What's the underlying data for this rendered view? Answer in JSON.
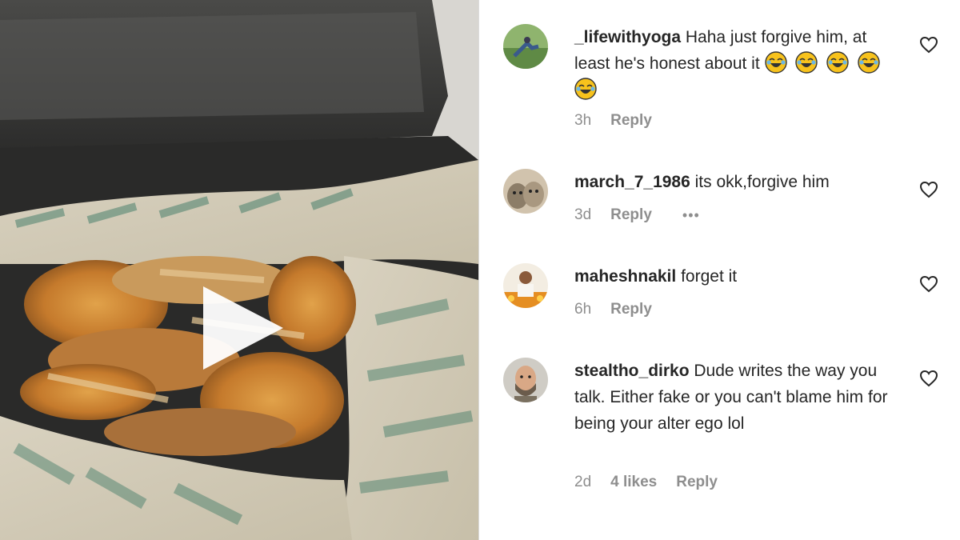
{
  "video": {
    "play_icon": "play-icon"
  },
  "comments": [
    {
      "username": "_lifewithyoga",
      "text": "Haha just forgive him, at least he's honest about it",
      "emoji": "face-with-tears-of-joy",
      "emoji_count": 5,
      "time": "3h",
      "likes": "",
      "reply": "Reply",
      "avatar_colors": [
        "#7aa35c",
        "#3a5a8c"
      ]
    },
    {
      "username": "march_7_1986",
      "text": "its okk,forgive him",
      "time": "3d",
      "likes": "",
      "reply": "Reply",
      "more": "•••",
      "avatar_colors": [
        "#b8a58a",
        "#6f6557"
      ]
    },
    {
      "username": "maheshnakil",
      "text": "forget it",
      "time": "6h",
      "likes": "",
      "reply": "Reply",
      "avatar_colors": [
        "#e9a23a",
        "#f6f0e4"
      ]
    },
    {
      "username": "stealtho_dirko",
      "text": "Dude writes the way you talk. Either fake or you can't blame him for being your alter ego lol",
      "time": "2d",
      "likes": "4 likes",
      "reply": "Reply",
      "avatar_colors": [
        "#c9c6bf",
        "#6b5c4c"
      ]
    }
  ],
  "icons": {
    "heart": "heart-outline-icon",
    "more": "more-options-icon"
  }
}
